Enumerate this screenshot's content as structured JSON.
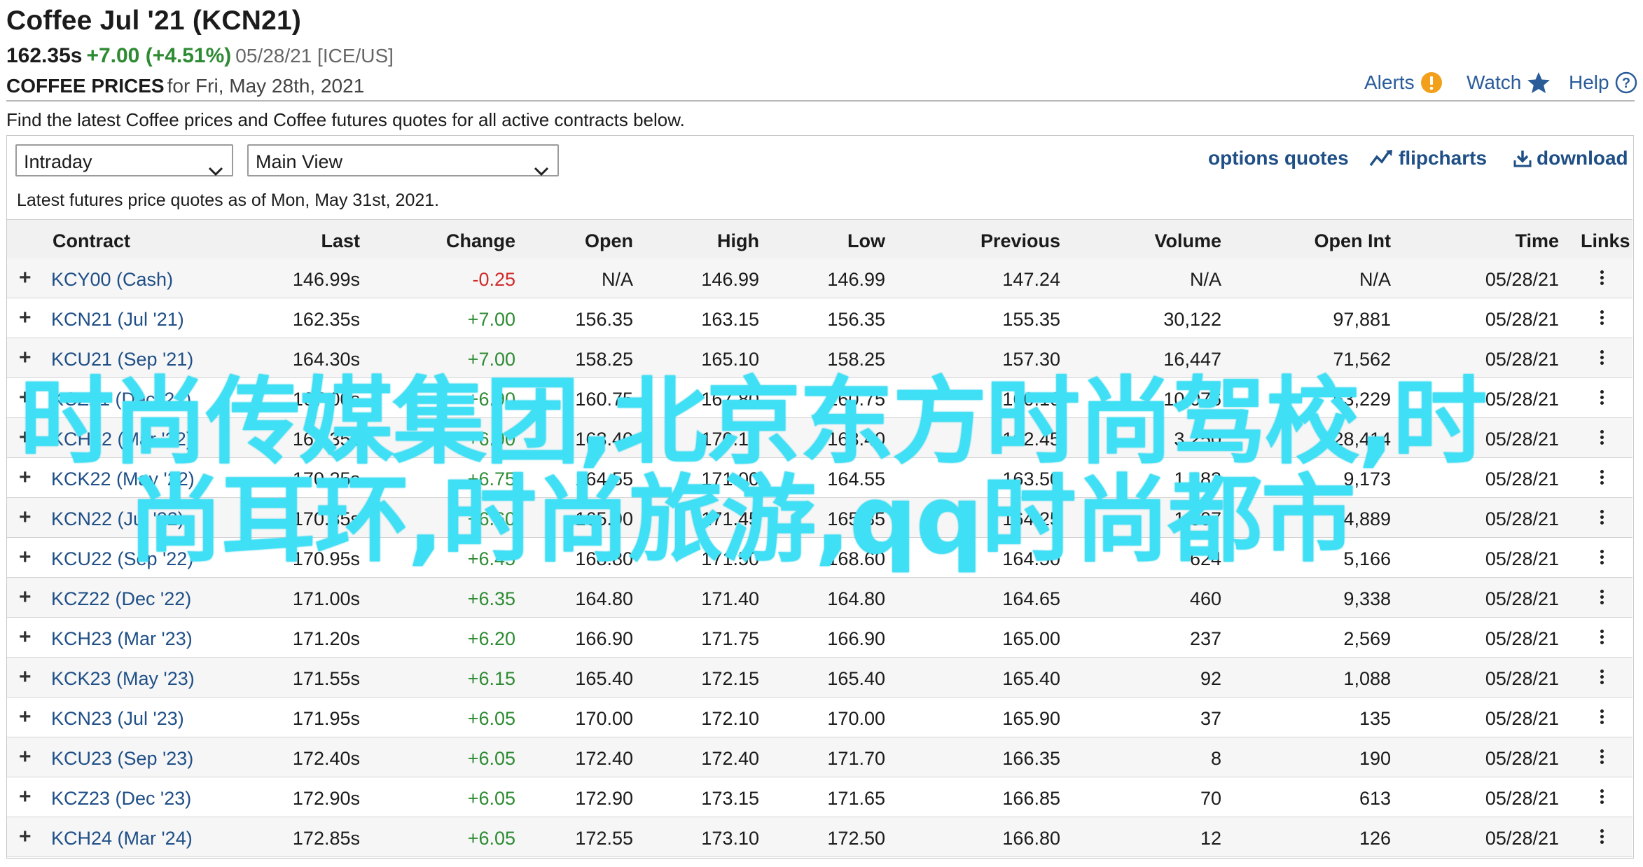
{
  "header": {
    "title": "Coffee Jul '21 (KCN21)",
    "last": "162.35s",
    "change": "+7.00 (+4.51%)",
    "meta": "05/28/21 [ICE/US]",
    "prices_label": "COFFEE PRICES",
    "prices_for": "for Fri, May 28th, 2021",
    "alerts_label": "Alerts",
    "watch_label": "Watch",
    "help_label": "Help"
  },
  "intro": "Find the latest Coffee prices and Coffee futures quotes for all active contracts below.",
  "controls": {
    "period_select": "Intraday",
    "view_select": "Main View",
    "options_quotes": "options quotes",
    "flipcharts": "flipcharts",
    "download": "download"
  },
  "as_of": "Latest futures price quotes as of Mon, May 31st, 2021.",
  "table": {
    "columns": [
      "Contract",
      "Last",
      "Change",
      "Open",
      "High",
      "Low",
      "Previous",
      "Volume",
      "Open Int",
      "Time",
      "Links"
    ],
    "rows": [
      {
        "contract": "KCY00 (Cash)",
        "last": "146.99s",
        "change": "-0.25",
        "open": "N/A",
        "high": "146.99",
        "low": "146.99",
        "previous": "147.24",
        "volume": "N/A",
        "open_int": "N/A",
        "time": "05/28/21"
      },
      {
        "contract": "KCN21 (Jul '21)",
        "last": "162.35s",
        "change": "+7.00",
        "open": "156.35",
        "high": "163.15",
        "low": "156.35",
        "previous": "155.35",
        "volume": "30,122",
        "open_int": "97,881",
        "time": "05/28/21"
      },
      {
        "contract": "KCU21 (Sep '21)",
        "last": "164.30s",
        "change": "+7.00",
        "open": "158.25",
        "high": "165.10",
        "low": "158.25",
        "previous": "157.30",
        "volume": "16,447",
        "open_int": "71,562",
        "time": "05/28/21"
      },
      {
        "contract": "KCZ21 (Dec '21)",
        "last": "167.00s",
        "change": "+6.90",
        "open": "160.75",
        "high": "167.80",
        "low": "160.75",
        "previous": "160.10",
        "volume": "10,076",
        "open_int": "53,229",
        "time": "05/28/21"
      },
      {
        "contract": "KCH22 (Mar '22)",
        "last": "169.35s",
        "change": "+6.90",
        "open": "163.40",
        "high": "170.15",
        "low": "163.40",
        "previous": "162.45",
        "volume": "3,250",
        "open_int": "28,414",
        "time": "05/28/21"
      },
      {
        "contract": "KCK22 (May '22)",
        "last": "170.25s",
        "change": "+6.75",
        "open": "164.55",
        "high": "171.00",
        "low": "164.55",
        "previous": "163.50",
        "volume": "1,183",
        "open_int": "9,173",
        "time": "05/28/21"
      },
      {
        "contract": "KCN22 (Jul '22)",
        "last": "170.85s",
        "change": "+6.60",
        "open": "165.90",
        "high": "171.45",
        "low": "165.85",
        "previous": "164.25",
        "volume": "1,007",
        "open_int": "4,889",
        "time": "05/28/21"
      },
      {
        "contract": "KCU22 (Sep '22)",
        "last": "170.95s",
        "change": "+6.45",
        "open": "168.80",
        "high": "171.50",
        "low": "168.60",
        "previous": "164.50",
        "volume": "624",
        "open_int": "5,166",
        "time": "05/28/21"
      },
      {
        "contract": "KCZ22 (Dec '22)",
        "last": "171.00s",
        "change": "+6.35",
        "open": "164.80",
        "high": "171.40",
        "low": "164.80",
        "previous": "164.65",
        "volume": "460",
        "open_int": "9,338",
        "time": "05/28/21"
      },
      {
        "contract": "KCH23 (Mar '23)",
        "last": "171.20s",
        "change": "+6.20",
        "open": "166.90",
        "high": "171.75",
        "low": "166.90",
        "previous": "165.00",
        "volume": "237",
        "open_int": "2,569",
        "time": "05/28/21"
      },
      {
        "contract": "KCK23 (May '23)",
        "last": "171.55s",
        "change": "+6.15",
        "open": "165.40",
        "high": "172.15",
        "low": "165.40",
        "previous": "165.40",
        "volume": "92",
        "open_int": "1,088",
        "time": "05/28/21"
      },
      {
        "contract": "KCN23 (Jul '23)",
        "last": "171.95s",
        "change": "+6.05",
        "open": "170.00",
        "high": "172.10",
        "low": "170.00",
        "previous": "165.90",
        "volume": "37",
        "open_int": "135",
        "time": "05/28/21"
      },
      {
        "contract": "KCU23 (Sep '23)",
        "last": "172.40s",
        "change": "+6.05",
        "open": "172.40",
        "high": "172.40",
        "low": "171.70",
        "previous": "166.35",
        "volume": "8",
        "open_int": "190",
        "time": "05/28/21"
      },
      {
        "contract": "KCZ23 (Dec '23)",
        "last": "172.90s",
        "change": "+6.05",
        "open": "172.90",
        "high": "173.15",
        "low": "171.65",
        "previous": "166.85",
        "volume": "70",
        "open_int": "613",
        "time": "05/28/21"
      },
      {
        "contract": "KCH24 (Mar '24)",
        "last": "172.85s",
        "change": "+6.05",
        "open": "172.55",
        "high": "173.10",
        "low": "172.50",
        "previous": "166.80",
        "volume": "12",
        "open_int": "126",
        "time": "05/28/21"
      }
    ]
  },
  "overlay": {
    "line1": "时尚传媒集团,北京东方时尚驾校,时",
    "line2": "尚耳环,时尚旅游,qq时尚都市",
    "color": "#3fe0f5"
  },
  "colors": {
    "link": "#1f4f86",
    "positive": "#2e8b33",
    "negative": "#d02b2b",
    "alert_badge": "#f2a01b",
    "watch_star": "#2a5c9a"
  }
}
